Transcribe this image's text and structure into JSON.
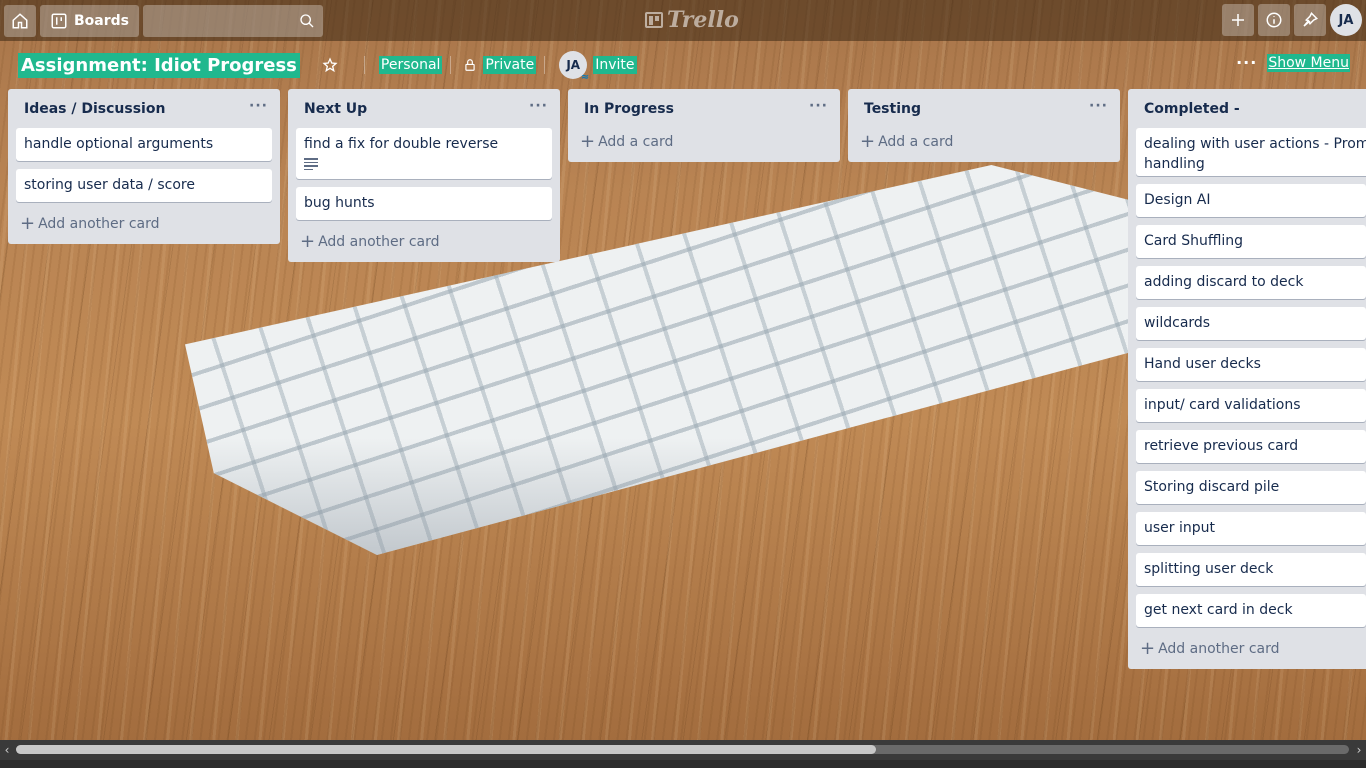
{
  "header": {
    "boards_label": "Boards",
    "logo_text": "Trello",
    "user_initials": "JA"
  },
  "board": {
    "title": "Assignment: Idiot Progress",
    "team_label": "Personal",
    "visibility_label": "Private",
    "member_initials": "JA",
    "invite_label": "Invite",
    "menu_dots": "···",
    "show_menu_label": "Show Menu"
  },
  "lists": [
    {
      "title": "Ideas / Discussion",
      "menu": "···",
      "cards": [
        "handle optional arguments",
        "storing user data / score"
      ],
      "add_label": "Add another card"
    },
    {
      "title": "Next Up",
      "menu": "···",
      "cards": [
        "find a fix for double reverse",
        "bug hunts"
      ],
      "add_label": "Add another card"
    },
    {
      "title": "In Progress",
      "menu": "···",
      "cards": [],
      "add_label": "Add a card"
    },
    {
      "title": "Testing",
      "menu": "···",
      "cards": [],
      "add_label": "Add a card"
    },
    {
      "title": "Completed -",
      "menu": "···",
      "cards": [
        "dealing with user actions - Prompt handling",
        "Design AI",
        "Card Shuffling",
        "adding discard to deck",
        "wildcards",
        "Hand user decks",
        "input/ card validations",
        "retrieve previous card",
        "Storing discard pile",
        "user input",
        "splitting user deck",
        "get next card in deck"
      ],
      "add_label": "Add another card"
    }
  ],
  "colors": {
    "highlight": "#20b88e",
    "list_bg": "#dfe1e6",
    "header_bg": "#3c2814"
  }
}
